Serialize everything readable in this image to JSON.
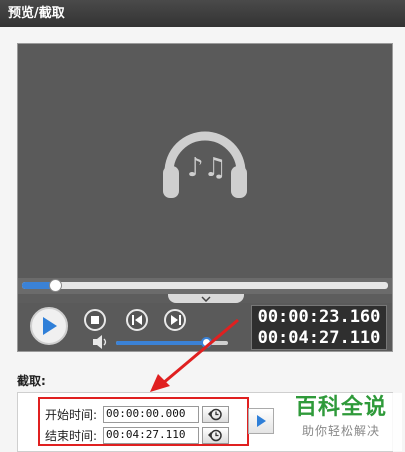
{
  "window": {
    "title": "预览/截取"
  },
  "player": {
    "seek_progress": 0.09,
    "volume_level": 0.8,
    "current_time": "00:00:23.160",
    "total_time": "00:04:27.110",
    "icons": {
      "media": "headphones-music-icon",
      "play": "play-icon",
      "stop": "stop-icon",
      "prev": "previous-icon",
      "next": "next-icon",
      "volume": "speaker-icon",
      "toggle": "chevron-down-icon"
    }
  },
  "clip": {
    "section_label": "截取:",
    "start_label": "开始时间:",
    "start_value": "00:00:00.000",
    "end_label": "结束时间:",
    "end_value": "00:04:27.110"
  },
  "watermark": {
    "main": "百科全说",
    "sub": "助你轻松解决"
  },
  "colors": {
    "accent": "#3b82d6",
    "highlight_border": "#e02020",
    "watermark_green": "#2f9a3a"
  }
}
